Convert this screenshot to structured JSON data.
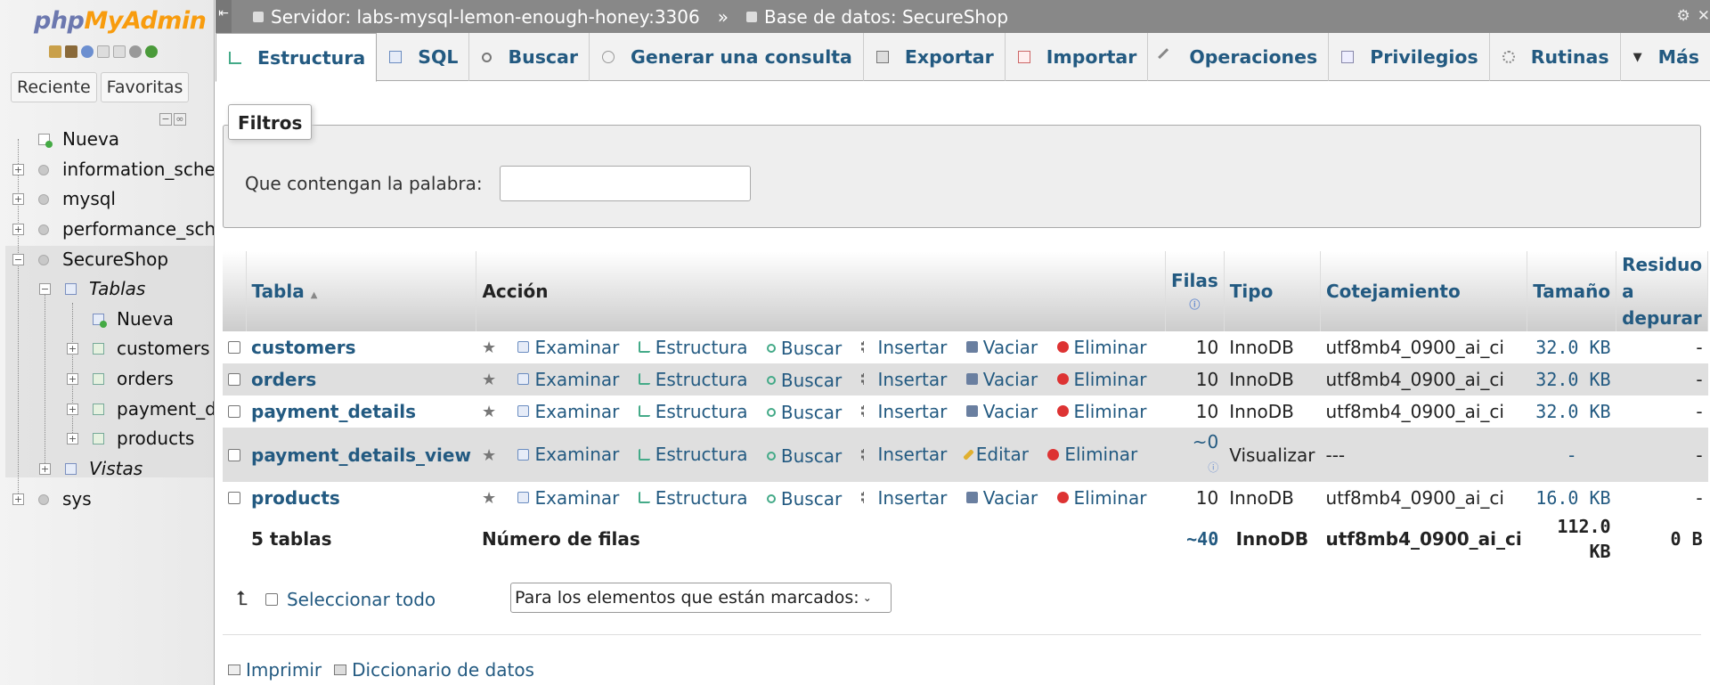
{
  "app": {
    "logo_part1": "php",
    "logo_part2": "MyAdmin"
  },
  "nav": {
    "tabs": [
      "Reciente",
      "Favoritas"
    ],
    "tree": [
      {
        "label": "Nueva"
      },
      {
        "label": "information_schema"
      },
      {
        "label": "mysql"
      },
      {
        "label": "performance_schema"
      },
      {
        "label": "SecureShop"
      },
      {
        "label": "Tablas"
      },
      {
        "label": "Nueva"
      },
      {
        "label": "customers"
      },
      {
        "label": "orders"
      },
      {
        "label": "payment_details"
      },
      {
        "label": "products"
      },
      {
        "label": "Vistas"
      },
      {
        "label": "sys"
      }
    ]
  },
  "breadcrumb": {
    "server": "Servidor: labs-mysql-lemon-enough-honey:3306",
    "separator": "»",
    "database": "Base de datos: SecureShop"
  },
  "tabs": [
    "Estructura",
    "SQL",
    "Buscar",
    "Generar una consulta",
    "Exportar",
    "Importar",
    "Operaciones",
    "Privilegios",
    "Rutinas",
    "Más"
  ],
  "filters": {
    "legend": "Filtros",
    "label": "Que contengan la palabra:",
    "value": ""
  },
  "table": {
    "headers": {
      "table": "Tabla",
      "action": "Acción",
      "rows": "Filas",
      "type": "Tipo",
      "collation": "Cotejamiento",
      "size": "Tamaño",
      "overhead_1": "Residuo",
      "overhead_2": "a",
      "overhead_3": "depurar"
    },
    "actions": {
      "browse": "Examinar",
      "structure": "Estructura",
      "search": "Buscar",
      "insert": "Insertar",
      "empty": "Vaciar",
      "edit": "Editar",
      "drop": "Eliminar"
    },
    "rows": [
      {
        "name": "customers",
        "rows": "10",
        "type": "InnoDB",
        "collation": "utf8mb4_0900_ai_ci",
        "size": "32.0 KB",
        "overhead": "-"
      },
      {
        "name": "orders",
        "rows": "10",
        "type": "InnoDB",
        "collation": "utf8mb4_0900_ai_ci",
        "size": "32.0 KB",
        "overhead": "-"
      },
      {
        "name": "payment_details",
        "rows": "10",
        "type": "InnoDB",
        "collation": "utf8mb4_0900_ai_ci",
        "size": "32.0 KB",
        "overhead": "-"
      },
      {
        "name": "payment_details_view",
        "rows": "~0",
        "type": "Visualizar",
        "collation": "---",
        "size": "-",
        "overhead": "-"
      },
      {
        "name": "products",
        "rows": "10",
        "type": "InnoDB",
        "collation": "utf8mb4_0900_ai_ci",
        "size": "16.0 KB",
        "overhead": "-"
      }
    ],
    "footer": {
      "count": "5 tablas",
      "label": "Número de filas",
      "rows": "~40",
      "type": "InnoDB",
      "collation": "utf8mb4_0900_ai_ci",
      "size_1": "112.0",
      "size_2": "KB",
      "overhead": "0 B"
    }
  },
  "bulk": {
    "select_all": "Seleccionar todo",
    "with_selected": "Para los elementos que están marcados:"
  },
  "footer_links": {
    "print": "Imprimir",
    "dictionary": "Diccionario de datos"
  }
}
